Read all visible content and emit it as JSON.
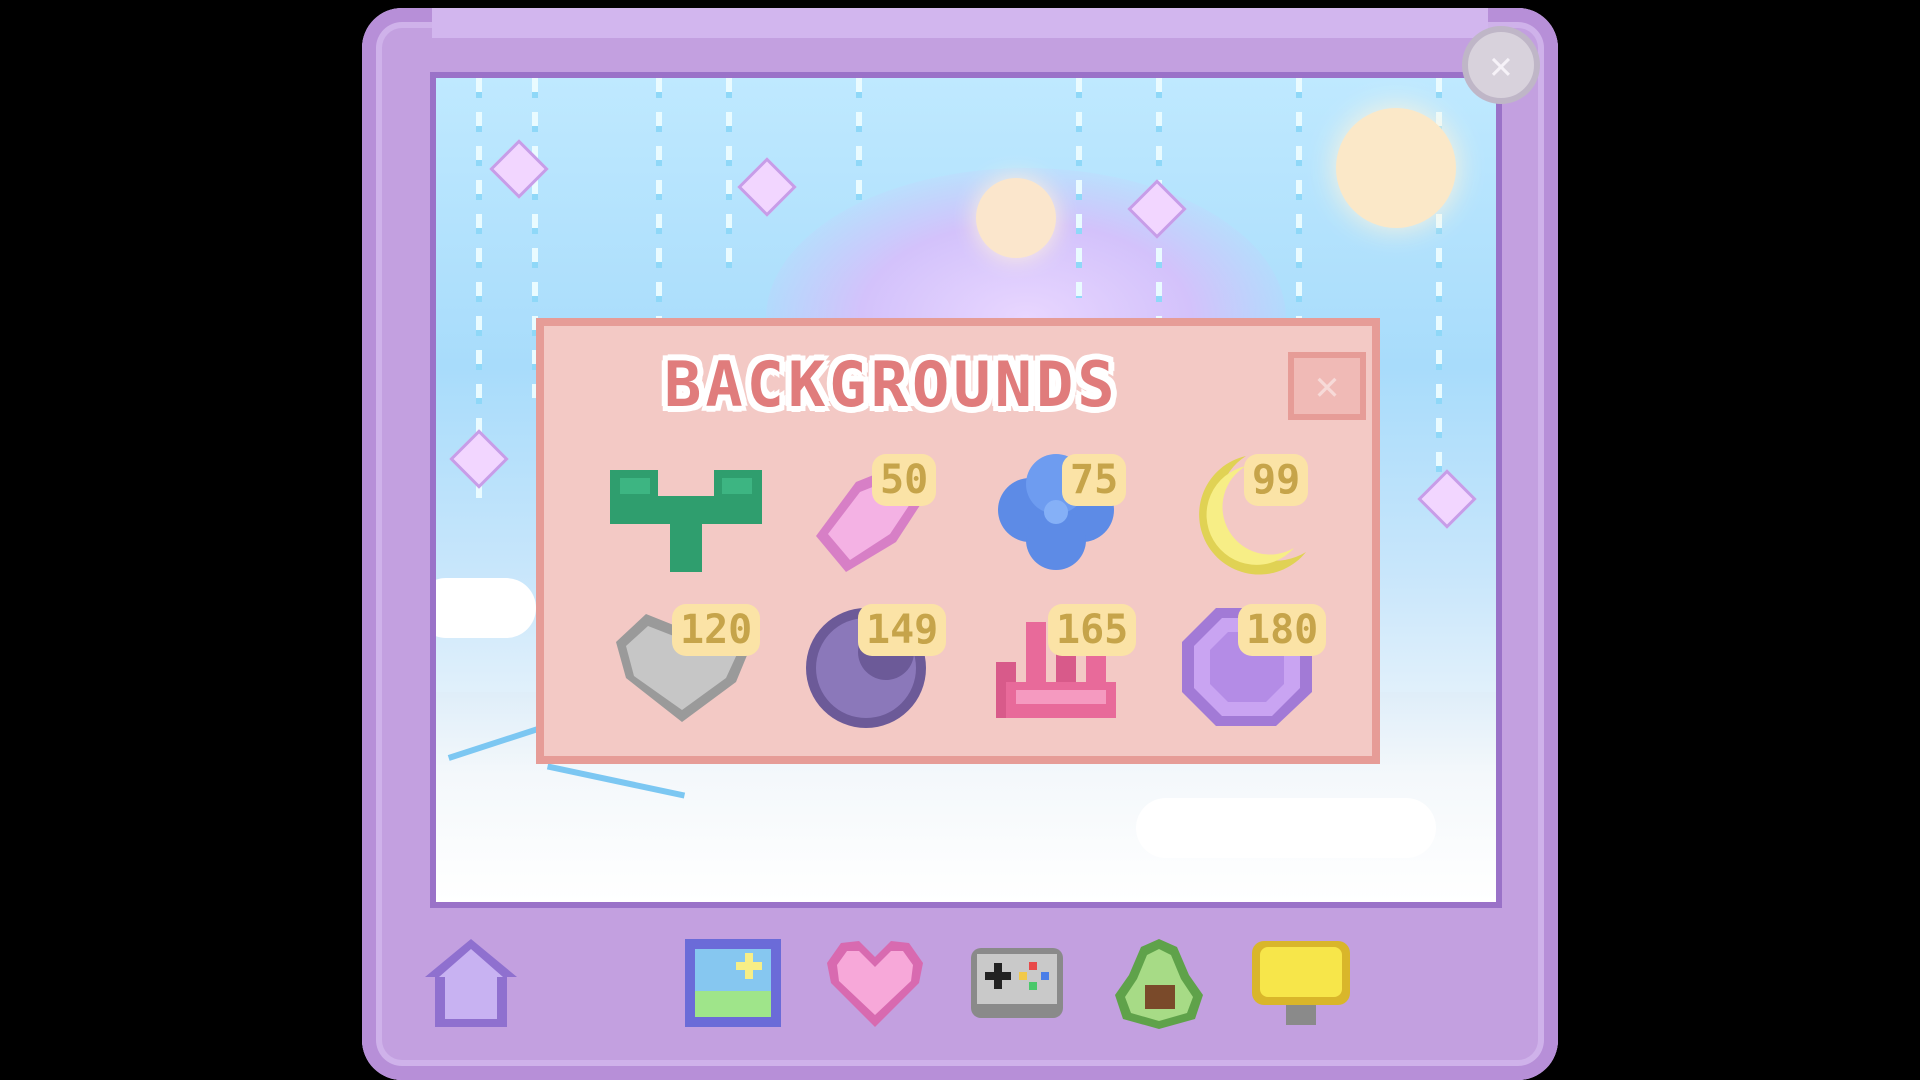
{
  "panel": {
    "title": "BACKGROUNDS",
    "close_label": "✕"
  },
  "window": {
    "close_label": "✕"
  },
  "backgrounds": [
    {
      "icon": "sprout-icon",
      "price": "",
      "color": "#2f9e6e"
    },
    {
      "icon": "pink-crystal-icon",
      "price": "50",
      "color": "#f0a3d9"
    },
    {
      "icon": "blue-flower-icon",
      "price": "75",
      "color": "#5d8be6"
    },
    {
      "icon": "crescent-moon-icon",
      "price": "99",
      "color": "#f7ee86"
    },
    {
      "icon": "gray-heart-rock-icon",
      "price": "120",
      "color": "#b9b9b9"
    },
    {
      "icon": "purple-planet-icon",
      "price": "149",
      "color": "#7e6aa8"
    },
    {
      "icon": "pink-coral-icon",
      "price": "165",
      "color": "#e86a9a"
    },
    {
      "icon": "purple-gem-icon",
      "price": "180",
      "color": "#c39be8"
    }
  ],
  "nav": [
    {
      "icon": "home-icon"
    },
    {
      "icon": "backgrounds-icon"
    },
    {
      "icon": "heart-icon"
    },
    {
      "icon": "gamepad-icon"
    },
    {
      "icon": "avocado-icon"
    },
    {
      "icon": "lamp-icon"
    }
  ]
}
